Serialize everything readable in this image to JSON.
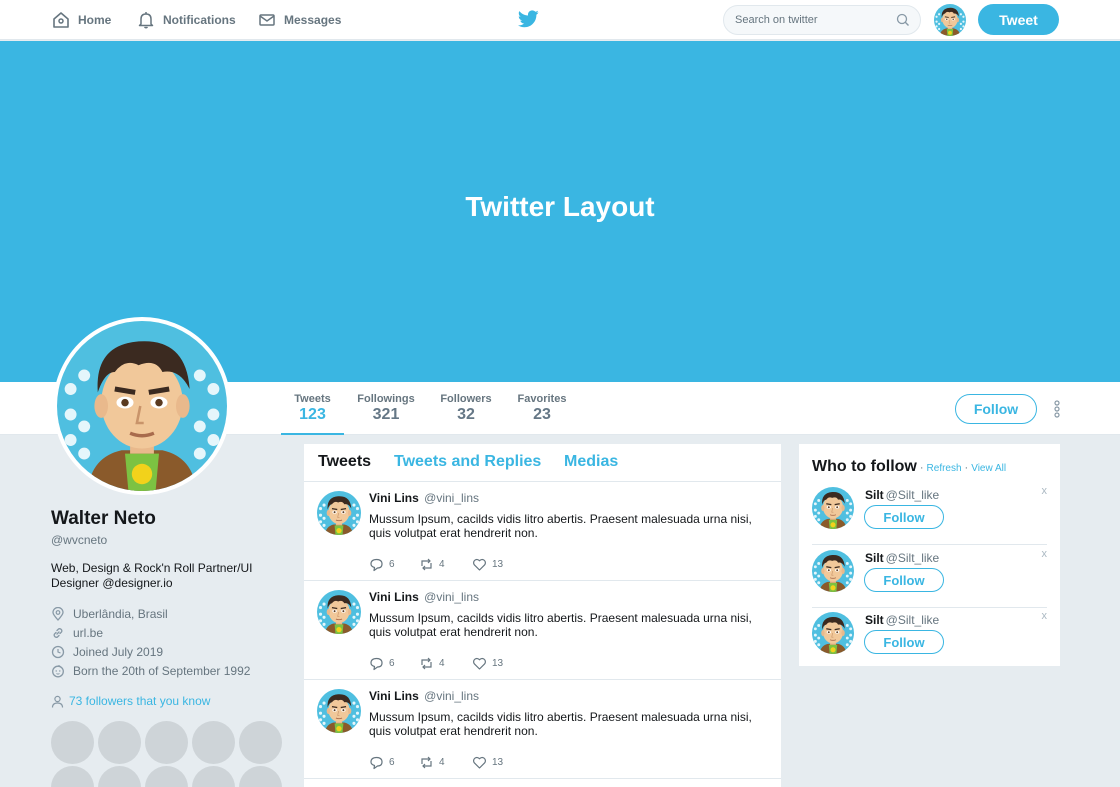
{
  "nav": {
    "home": "Home",
    "notifications": "Notifications",
    "messages": "Messages",
    "search_placeholder": "Search on twitter",
    "tweet_button": "Tweet"
  },
  "banner": {
    "title": "Twitter Layout"
  },
  "stats": [
    {
      "label": "Tweets",
      "value": "123"
    },
    {
      "label": "Followings",
      "value": "321"
    },
    {
      "label": "Followers",
      "value": "32"
    },
    {
      "label": "Favorites",
      "value": "23"
    }
  ],
  "follow_button": "Follow",
  "profile": {
    "name": "Walter Neto",
    "handle": "@wvcneto",
    "bio": "Web, Design & Rock'n Roll Partner/UI Designer @designer.io",
    "location": "Uberlândia, Brasil",
    "url": "url.be",
    "joined": "Joined July 2019",
    "born": "Born the 20th of September 1992",
    "followers_you_know": "73 followers that you know"
  },
  "tabs": [
    "Tweets",
    "Tweets and Replies",
    "Medias"
  ],
  "tweets": [
    {
      "name": "Vini Lins",
      "handle": "@vini_lins",
      "text": "Mussum Ipsum, cacilds vidis litro abertis. Praesent malesuada urna nisi, quis volutpat erat hendrerit non.",
      "replies": "6",
      "retweets": "4",
      "likes": "13"
    },
    {
      "name": "Vini Lins",
      "handle": "@vini_lins",
      "text": "Mussum Ipsum, cacilds vidis litro abertis. Praesent malesuada urna nisi, quis volutpat erat hendrerit non.",
      "replies": "6",
      "retweets": "4",
      "likes": "13"
    },
    {
      "name": "Vini Lins",
      "handle": "@vini_lins",
      "text": "Mussum Ipsum, cacilds vidis litro abertis. Praesent malesuada urna nisi, quis volutpat erat hendrerit non.",
      "replies": "6",
      "retweets": "4",
      "likes": "13"
    }
  ],
  "who_to_follow": {
    "title": "Who to follow",
    "separator": "·",
    "refresh": "Refresh",
    "view_all": "View All",
    "close": "x",
    "suggestions": [
      {
        "name": "Silt",
        "handle": "@Silt_like",
        "button": "Follow"
      },
      {
        "name": "Silt",
        "handle": "@Silt_like",
        "button": "Follow"
      },
      {
        "name": "Silt",
        "handle": "@Silt_like",
        "button": "Follow"
      }
    ]
  },
  "colors": {
    "accent": "#3ab6e2",
    "background": "#e6ecf0",
    "muted_text": "#66757f"
  },
  "icons": [
    "home-icon",
    "bell-icon",
    "envelope-icon",
    "twitter-bird-icon",
    "search-icon",
    "more-dots-icon",
    "location-pin-icon",
    "link-icon",
    "clock-icon",
    "baby-face-icon",
    "person-icon",
    "reply-icon",
    "retweet-icon",
    "heart-icon"
  ]
}
